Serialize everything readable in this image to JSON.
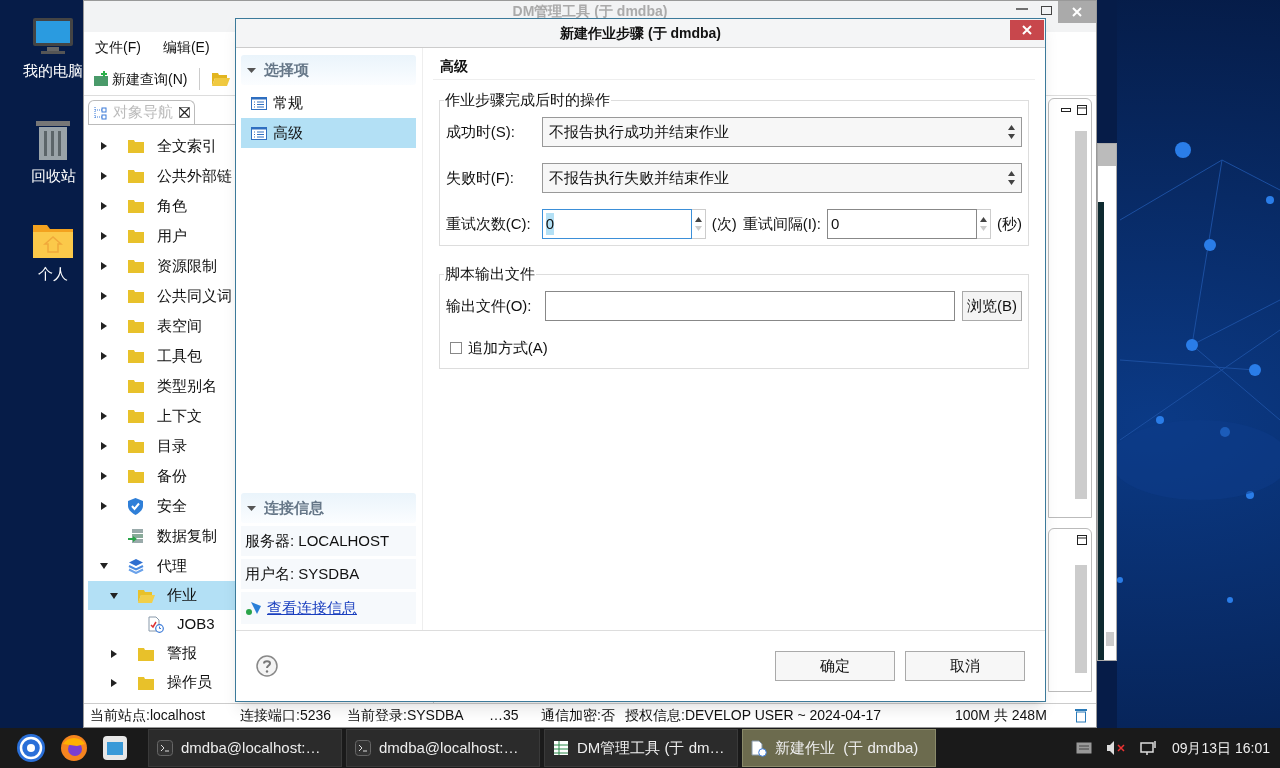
{
  "desktop": {
    "icons": [
      {
        "label": "我的电脑",
        "kind": "computer"
      },
      {
        "label": "回收站",
        "kind": "trash"
      },
      {
        "label": "个人",
        "kind": "home"
      }
    ]
  },
  "main_window": {
    "title": "DM管理工具 (于 dmdba)",
    "menu": [
      "文件(F)",
      "编辑(E)"
    ],
    "toolbar": {
      "new_query": "新建查询(N)"
    },
    "nav_tab": "对象导航",
    "tree": [
      {
        "label": "全文索引",
        "kind": "folder",
        "expanded": false,
        "selected": false
      },
      {
        "label": "公共外部链",
        "kind": "folder",
        "expanded": false,
        "selected": false
      },
      {
        "label": "角色",
        "kind": "folder",
        "expanded": false,
        "selected": false
      },
      {
        "label": "用户",
        "kind": "folder",
        "expanded": false,
        "selected": false
      },
      {
        "label": "资源限制",
        "kind": "folder",
        "expanded": false,
        "selected": false
      },
      {
        "label": "公共同义词",
        "kind": "folder",
        "expanded": false,
        "selected": false
      },
      {
        "label": "表空间",
        "kind": "folder",
        "expanded": false,
        "selected": false
      },
      {
        "label": "工具包",
        "kind": "folder",
        "expanded": false,
        "selected": false
      },
      {
        "label": "类型别名",
        "kind": "folder",
        "selected": false
      },
      {
        "label": "上下文",
        "kind": "folder",
        "expanded": false,
        "selected": false
      },
      {
        "label": "目录",
        "kind": "folder",
        "expanded": false,
        "selected": false
      },
      {
        "label": "备份",
        "kind": "folder",
        "expanded": false,
        "selected": false
      },
      {
        "label": "安全",
        "kind": "shield",
        "expanded": false,
        "selected": false
      },
      {
        "label": "数据复制",
        "kind": "replication",
        "selected": false
      },
      {
        "label": "代理",
        "kind": "layers",
        "expanded": true,
        "selected": false,
        "children": [
          {
            "label": "作业",
            "kind": "folder-open",
            "expanded": true,
            "selected": true,
            "children": [
              {
                "label": "JOB3",
                "kind": "job",
                "selected": false
              }
            ]
          },
          {
            "label": "警报",
            "kind": "folder",
            "expanded": false,
            "selected": false
          },
          {
            "label": "操作员",
            "kind": "folder",
            "expanded": false,
            "selected": false
          }
        ]
      }
    ],
    "status_bar": [
      "当前站点:localhost",
      "连接端口:5236",
      "当前登录:SYSDBA",
      "…35",
      "通信加密:否",
      "授权信息:DEVELOP USER ~ 2024-04-17",
      "100M 共 248M"
    ]
  },
  "dialog": {
    "title": "新建作业步骤 (于 dmdba)",
    "options": {
      "title": "选择项",
      "expanded": true,
      "items": [
        {
          "label": "常规",
          "selected": false
        },
        {
          "label": "高级",
          "selected": true
        }
      ]
    },
    "connection": {
      "title": "连接信息",
      "expanded": true,
      "server": "服务器: LOCALHOST",
      "user": "用户名: SYSDBA",
      "link": "查看连接信息"
    },
    "page_title": "高级",
    "completion_group": {
      "title": "作业步骤完成后时的操作",
      "on_success": {
        "label": "成功时(S):",
        "value": "不报告执行成功并结束作业"
      },
      "on_failure": {
        "label": "失败时(F):",
        "value": "不报告执行失败并结束作业"
      },
      "retry_count": {
        "label": "重试次数(C):",
        "value": "0",
        "unit": "(次)",
        "focused": true
      },
      "retry_interval": {
        "label": "重试间隔(I):",
        "value": "0",
        "unit": "(秒)",
        "focused": false
      }
    },
    "output_group": {
      "title": "脚本输出文件",
      "file_label": "输出文件(O):",
      "browse": "浏览(B)",
      "append": {
        "label": "追加方式(A)",
        "checked": false
      }
    },
    "buttons": [
      "确定",
      "取消"
    ]
  },
  "taskbar": {
    "tasks": [
      {
        "label": "dmdba@localhost:…",
        "kind": "terminal",
        "selected": false
      },
      {
        "label": "dmdba@localhost:…",
        "kind": "terminal",
        "selected": false
      },
      {
        "label": "DM管理工具 (于 dm…",
        "kind": "app",
        "selected": false
      },
      {
        "label": "新建作业  (于 dmdba)",
        "kind": "dialog",
        "selected": true
      }
    ],
    "clock": "09月13日 16:01"
  }
}
